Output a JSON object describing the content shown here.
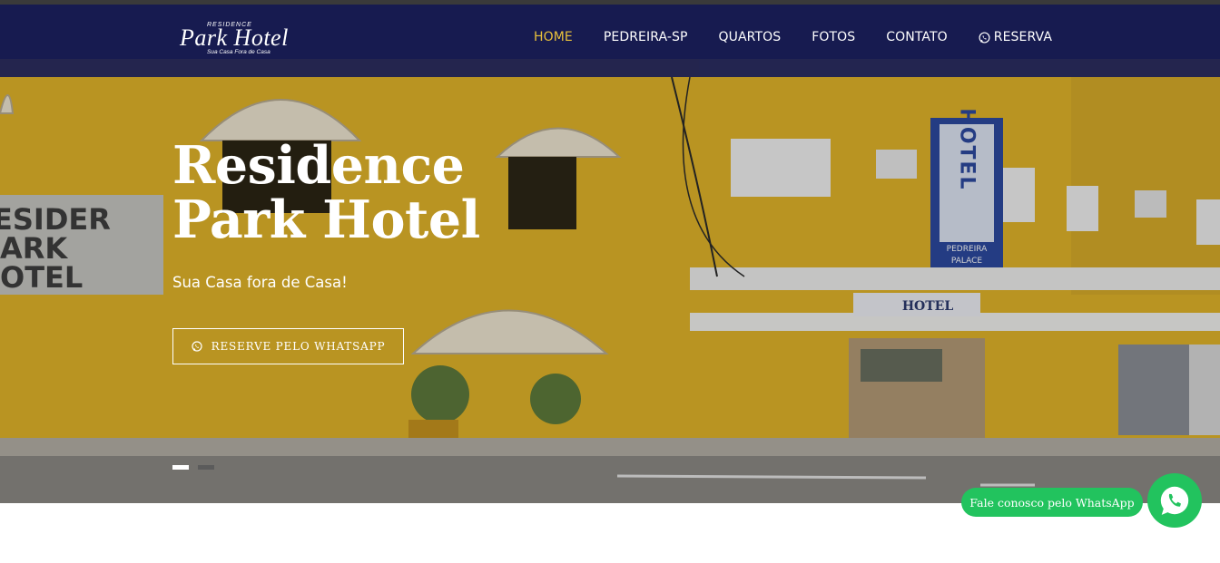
{
  "brand": {
    "logo_top": "RESIDENCE",
    "logo_main": "Park Hotel",
    "logo_tagline": "Sua Casa Fora de Casa"
  },
  "nav": {
    "items": [
      {
        "label": "HOME",
        "active": true
      },
      {
        "label": "PEDREIRA-SP",
        "active": false
      },
      {
        "label": "QUARTOS",
        "active": false
      },
      {
        "label": "FOTOS",
        "active": false
      },
      {
        "label": "CONTATO",
        "active": false
      }
    ],
    "reserve_label": "RESERVA",
    "reserve_icon": "whatsapp-icon"
  },
  "hero": {
    "title_line1": "Residence",
    "title_line2": "Park Hotel",
    "subtitle": "Sua Casa fora de Casa!",
    "button_label": "RESERVE PELO WHATSAPP",
    "button_icon": "whatsapp-icon",
    "slides": 2,
    "active_slide": 1,
    "sign_left": [
      "ESIDER",
      "ARK",
      "OTEL"
    ],
    "sign_vertical": "HOTEL",
    "sign_vertical_sub": [
      "PEDREIRA",
      "PALACE"
    ],
    "sign_front": "HOTEL"
  },
  "whatsapp_widget": {
    "label": "Fale conosco pelo WhatsApp",
    "icon": "whatsapp-icon"
  },
  "colors": {
    "nav_bg": "#181c52",
    "nav_active": "#e9c13b",
    "whatsapp_green": "#22c35e",
    "wall_yellow": "#e2b52a"
  }
}
